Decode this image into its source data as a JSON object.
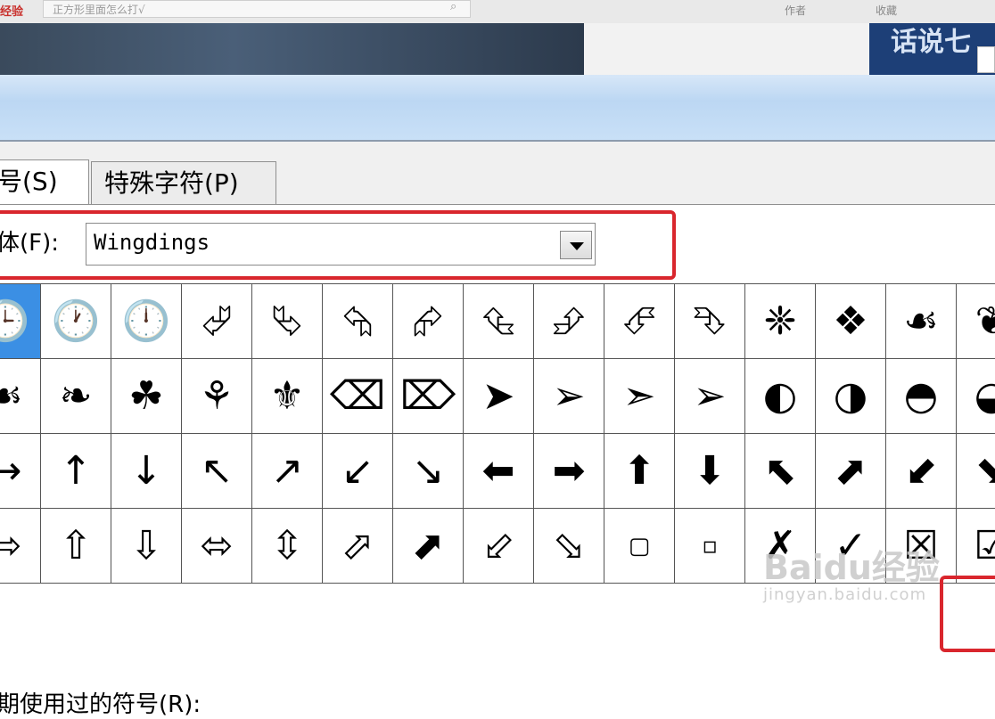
{
  "background": {
    "logo_text": "经验",
    "search_text": "正方形里面怎么打√",
    "search_icon": "search-icon",
    "links": [
      "作者",
      "收藏"
    ],
    "banner_text": "话说七"
  },
  "dialog": {
    "tabs": [
      {
        "label": "号(S)",
        "active": true
      },
      {
        "label": "特殊字符(P)",
        "active": false
      }
    ],
    "font": {
      "label": "体(F):",
      "value": "Wingdings",
      "dropdown_icon": "chevron-down-icon"
    },
    "symbols": [
      [
        "🕒",
        "🕐",
        "🕛",
        "⮰",
        "⮱",
        "⮲",
        "⮳",
        "⮴",
        "⮵",
        "⮶",
        "⮷",
        "❈",
        "❖",
        "☙",
        "❦"
      ],
      [
        "☙",
        "❧",
        "☘",
        "⚘",
        "⚜",
        "⌫",
        "⌦",
        "➤",
        "➢",
        "➣",
        "➢",
        "◐",
        "◑",
        "◓",
        "◒"
      ],
      [
        "→",
        "↑",
        "↓",
        "↖",
        "↗",
        "↙",
        "↘",
        "⬅",
        "➡",
        "⬆",
        "⬇",
        "⬉",
        "⬈",
        "⬋",
        "⬊"
      ],
      [
        "⇨",
        "⇧",
        "⇩",
        "⬄",
        "⇳",
        "⬀",
        "⬈",
        "⬃",
        "⬂",
        "▢",
        "▫",
        "✗",
        "✓",
        "☒",
        "☑"
      ]
    ],
    "selected_index": 0,
    "recent_label": "期使用过的符号(R):"
  },
  "watermark": {
    "brand": "Baidu经验",
    "url": "jingyan.baidu.com"
  }
}
